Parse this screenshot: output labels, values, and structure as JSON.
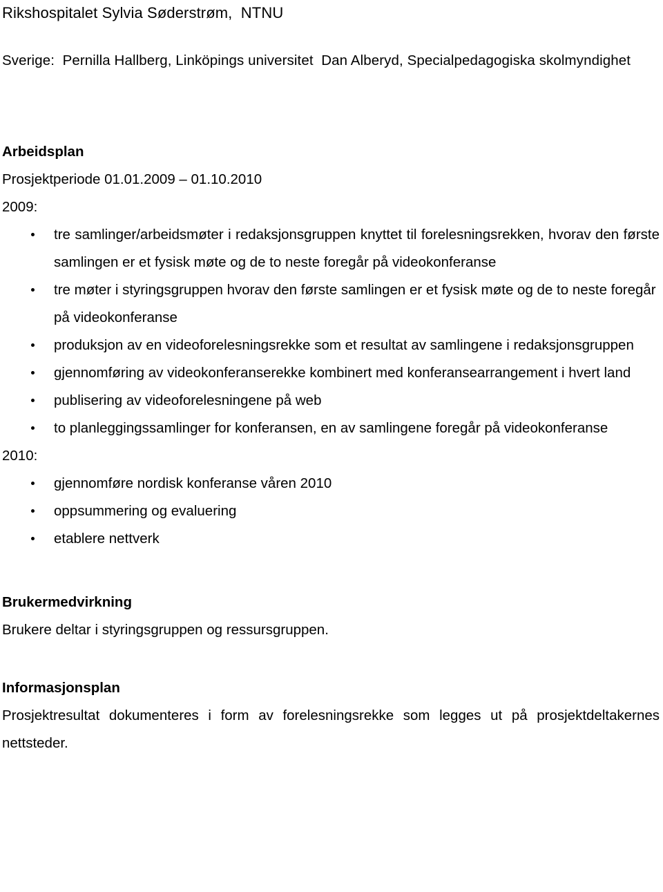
{
  "document": {
    "header_lines": [
      "Rikshospitalet Sylvia Søderstrøm,  NTNU",
      "Sverige:  Pernilla Hallberg, Linköpings universitet  Dan Alberyd, Specialpedagogiska skolmyndighet"
    ],
    "sections": {
      "arbeidsplan": {
        "heading": "Arbeidsplan",
        "project_period": "Prosjektperiode 01.01.2009  – 01.10.2010",
        "year_2009_label": "2009:",
        "bullets_2009": [
          "tre samlinger/arbeidsmøter i redaksjonsgruppen knyttet til forelesningsrekken, hvorav den første samlingen er et fysisk møte og de to neste foregår på videokonferanse",
          "tre møter i styringsgruppen  hvorav den første samlingen er et fysisk møte og de to neste foregår på videokonferanse",
          "produksjon av en videoforelesningsrekke som et resultat av samlingene i redaksjonsgruppen",
          "gjennomføring av videokonferanserekke kombinert med konferansearrangement i hvert land",
          "publisering av videoforelesningene på web",
          "to planleggingssamlinger for konferansen, en av samlingene   foregår på videokonferanse"
        ],
        "year_2010_label": "2010:",
        "bullets_2010": [
          "gjennomføre nordisk konferanse våren 2010",
          "oppsummering og evaluering",
          "etablere nettverk"
        ]
      },
      "brukermedvirkning": {
        "heading": "Brukermedvirkning",
        "body": "Brukere deltar i styringsgruppen og ressursgruppen."
      },
      "informasjonsplan": {
        "heading": "Informasjonsplan",
        "body": "Prosjektresultat dokumenteres i form av forelesningsrekke som legges ut på prosjektdeltakernes nettsteder."
      }
    }
  },
  "colors": {
    "text": "#000000",
    "background": "#ffffff"
  }
}
